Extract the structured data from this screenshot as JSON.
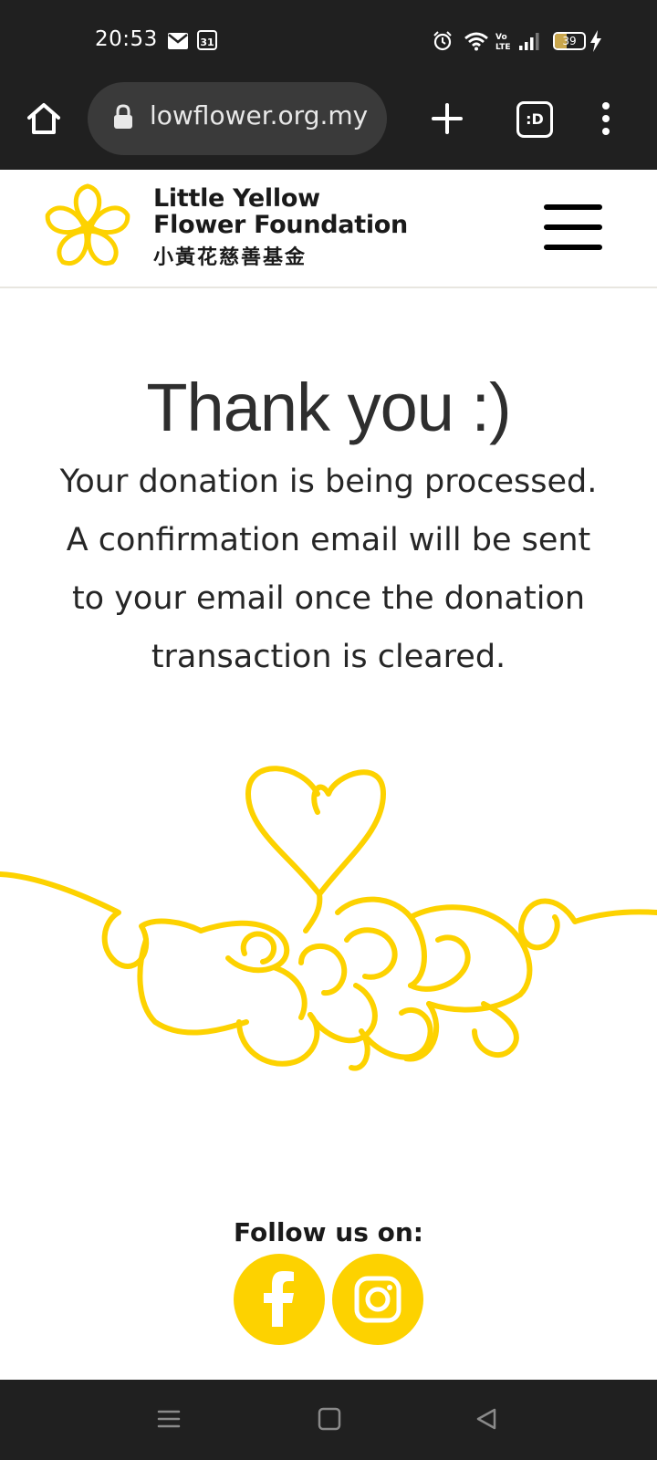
{
  "status_bar": {
    "time": "20:53",
    "battery_level": "39",
    "icons": [
      "mail-icon",
      "calendar-icon",
      "alarm-icon",
      "wifi-icon",
      "volte-icon",
      "signal-icon",
      "battery-icon",
      "charging-icon"
    ],
    "calendar_day": "31"
  },
  "browser": {
    "url": "lowflower.org.my",
    "tabs_label": ":D",
    "icons": [
      "home-icon",
      "lock-icon",
      "plus-icon",
      "more-vert-icon"
    ]
  },
  "site_header": {
    "brand_line1": "Little Yellow",
    "brand_line2": "Flower Foundation",
    "brand_chinese": "小黃花慈善基金",
    "logo_icon": "flower-logo-icon",
    "menu_icon": "hamburger-icon"
  },
  "main": {
    "title": "Thank you :)",
    "message": "Your donation is being processed. A confirmation email will be sent to your email once the donation transaction is cleared.",
    "illustration": "heart-hands-illustration"
  },
  "footer": {
    "follow_label": "Follow us on:",
    "social": [
      "facebook-icon",
      "instagram-icon"
    ]
  },
  "nav_bar": {
    "icons": [
      "recents-icon",
      "home-square-icon",
      "back-triangle-icon"
    ]
  },
  "colors": {
    "accent_yellow": "#fdd200",
    "chrome_dark": "#202020",
    "url_pill": "#3a3a3a",
    "text_dark": "#262626"
  }
}
